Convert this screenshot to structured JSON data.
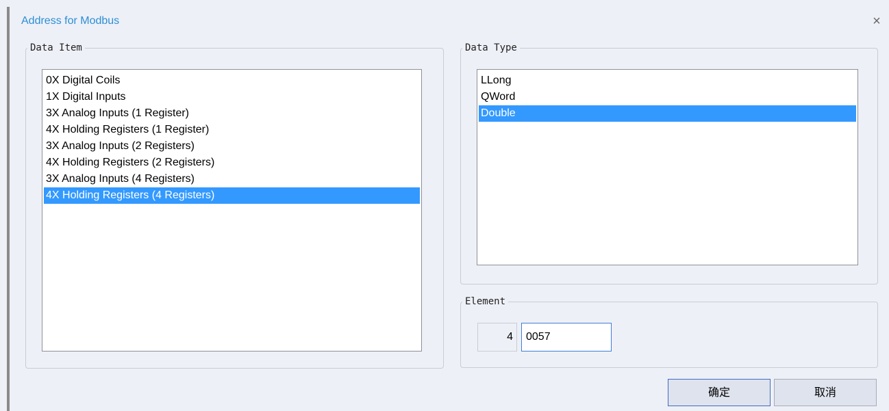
{
  "dialog": {
    "title": "Address for Modbus",
    "close_glyph": "×"
  },
  "data_item": {
    "legend": "Data Item",
    "items": [
      "0X Digital Coils",
      "1X Digital Inputs",
      "3X Analog Inputs (1 Register)",
      "4X Holding Registers (1 Register)",
      "3X Analog Inputs (2 Registers)",
      "4X Holding Registers (2 Registers)",
      "3X Analog Inputs (4 Registers)",
      "4X Holding Registers (4 Registers)"
    ],
    "selected_index": 7
  },
  "data_type": {
    "legend": "Data Type",
    "items": [
      "LLong",
      "QWord",
      "Double"
    ],
    "selected_index": 2
  },
  "element": {
    "legend": "Element",
    "prefix": "4",
    "value": "0057"
  },
  "buttons": {
    "ok_label": "确定",
    "cancel_label": "取消"
  },
  "colors": {
    "selection": "#3399ff",
    "title": "#2b8fd6"
  }
}
